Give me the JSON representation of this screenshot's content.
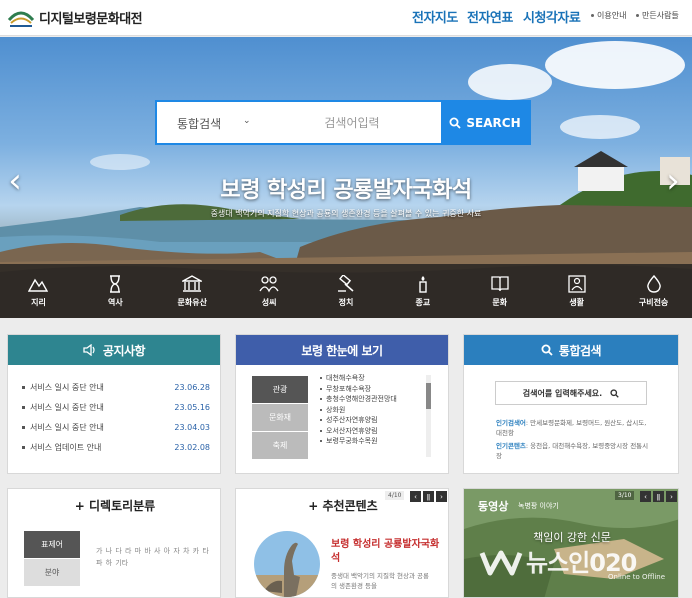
{
  "header": {
    "site_title": "디지털보령문화대전",
    "nav": [
      "전자지도",
      "전자연표",
      "시청각자료"
    ],
    "util": [
      "이용안내",
      "만든사람들"
    ]
  },
  "hero": {
    "search_category": "통합검색",
    "search_placeholder": "검색어입력",
    "search_button": "SEARCH",
    "title": "보령 학성리 공룡발자국화석",
    "subtitle": "중생대 백악기의 지질학 현상과 공룡의 생존환경 등을 살펴볼 수 있는 귀중한 사료",
    "categories": [
      {
        "label": "지리",
        "icon": "mountain-icon"
      },
      {
        "label": "역사",
        "icon": "hourglass-icon"
      },
      {
        "label": "문화유산",
        "icon": "temple-icon"
      },
      {
        "label": "성씨",
        "icon": "people-icon"
      },
      {
        "label": "정치",
        "icon": "gavel-icon"
      },
      {
        "label": "종교",
        "icon": "candle-icon"
      },
      {
        "label": "문화",
        "icon": "book-icon"
      },
      {
        "label": "생활",
        "icon": "person-frame-icon"
      },
      {
        "label": "구비전승",
        "icon": "water-drop-icon"
      }
    ]
  },
  "notice": {
    "title": "공지사항",
    "items": [
      {
        "text": "서비스 일시 중단 안내",
        "date": "23.06.28"
      },
      {
        "text": "서비스 일시 중단 안내",
        "date": "23.05.16"
      },
      {
        "text": "서비스 일시 중단 안내",
        "date": "23.04.03"
      },
      {
        "text": "서비스 업데이트 안내",
        "date": "23.02.08"
      }
    ]
  },
  "glance": {
    "title": "보령 한눈에 보기",
    "tabs": [
      "관광",
      "문화재",
      "축제"
    ],
    "items": [
      "대천해수욕장",
      "무창포해수욕장",
      "충청수영해안경관전망대",
      "상화원",
      "성주산자연휴양림",
      "오서산자연휴양림",
      "보령무궁화수목원"
    ]
  },
  "search_panel": {
    "title": "통합검색",
    "placeholder": "검색어를 입력해주세요.",
    "popular_label": "인기검색어",
    "popular_text": ": 만세보령문화제, 보령머드, 원산도, 삽시도, 대천항",
    "content_label": "인기콘텐츠",
    "content_text": ": 웅천읍, 대천해수욕장, 보령중앙시장 전통시장"
  },
  "directory": {
    "title": "+ 디렉토리분류",
    "tabs": [
      "표제어",
      "분야"
    ],
    "letters": "가 나 다 라 마 바 사 아 자 차 카 타 파 하 기타"
  },
  "recommend": {
    "title": "+ 추천콘텐츠",
    "page": "4/10",
    "item_title": "보령 학성리 공룡발자국화석",
    "item_desc": "중생대 백악기의 지질학 현상과 공룡의 생존환경 등을"
  },
  "video": {
    "title": "동영상",
    "caption": "녹병팡 이야기",
    "page": "3/10",
    "slogan": "책임이 강한 신문",
    "watermark": "뉴스인020",
    "watermark_sub": "Online to Offline"
  },
  "colors": {
    "notice": "#2e8590",
    "glance": "#3f5eaa",
    "search": "#2b7fbe",
    "accent": "#1e88e5"
  }
}
